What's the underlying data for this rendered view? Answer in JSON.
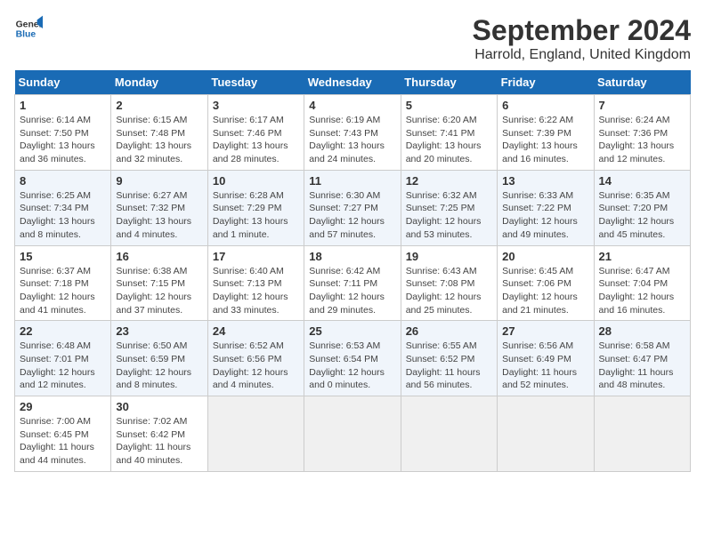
{
  "header": {
    "logo_line1": "General",
    "logo_line2": "Blue",
    "month_title": "September 2024",
    "location": "Harrold, England, United Kingdom"
  },
  "days_of_week": [
    "Sunday",
    "Monday",
    "Tuesday",
    "Wednesday",
    "Thursday",
    "Friday",
    "Saturday"
  ],
  "weeks": [
    [
      {
        "day": "1",
        "info": "Sunrise: 6:14 AM\nSunset: 7:50 PM\nDaylight: 13 hours\nand 36 minutes."
      },
      {
        "day": "2",
        "info": "Sunrise: 6:15 AM\nSunset: 7:48 PM\nDaylight: 13 hours\nand 32 minutes."
      },
      {
        "day": "3",
        "info": "Sunrise: 6:17 AM\nSunset: 7:46 PM\nDaylight: 13 hours\nand 28 minutes."
      },
      {
        "day": "4",
        "info": "Sunrise: 6:19 AM\nSunset: 7:43 PM\nDaylight: 13 hours\nand 24 minutes."
      },
      {
        "day": "5",
        "info": "Sunrise: 6:20 AM\nSunset: 7:41 PM\nDaylight: 13 hours\nand 20 minutes."
      },
      {
        "day": "6",
        "info": "Sunrise: 6:22 AM\nSunset: 7:39 PM\nDaylight: 13 hours\nand 16 minutes."
      },
      {
        "day": "7",
        "info": "Sunrise: 6:24 AM\nSunset: 7:36 PM\nDaylight: 13 hours\nand 12 minutes."
      }
    ],
    [
      {
        "day": "8",
        "info": "Sunrise: 6:25 AM\nSunset: 7:34 PM\nDaylight: 13 hours\nand 8 minutes."
      },
      {
        "day": "9",
        "info": "Sunrise: 6:27 AM\nSunset: 7:32 PM\nDaylight: 13 hours\nand 4 minutes."
      },
      {
        "day": "10",
        "info": "Sunrise: 6:28 AM\nSunset: 7:29 PM\nDaylight: 13 hours\nand 1 minute."
      },
      {
        "day": "11",
        "info": "Sunrise: 6:30 AM\nSunset: 7:27 PM\nDaylight: 12 hours\nand 57 minutes."
      },
      {
        "day": "12",
        "info": "Sunrise: 6:32 AM\nSunset: 7:25 PM\nDaylight: 12 hours\nand 53 minutes."
      },
      {
        "day": "13",
        "info": "Sunrise: 6:33 AM\nSunset: 7:22 PM\nDaylight: 12 hours\nand 49 minutes."
      },
      {
        "day": "14",
        "info": "Sunrise: 6:35 AM\nSunset: 7:20 PM\nDaylight: 12 hours\nand 45 minutes."
      }
    ],
    [
      {
        "day": "15",
        "info": "Sunrise: 6:37 AM\nSunset: 7:18 PM\nDaylight: 12 hours\nand 41 minutes."
      },
      {
        "day": "16",
        "info": "Sunrise: 6:38 AM\nSunset: 7:15 PM\nDaylight: 12 hours\nand 37 minutes."
      },
      {
        "day": "17",
        "info": "Sunrise: 6:40 AM\nSunset: 7:13 PM\nDaylight: 12 hours\nand 33 minutes."
      },
      {
        "day": "18",
        "info": "Sunrise: 6:42 AM\nSunset: 7:11 PM\nDaylight: 12 hours\nand 29 minutes."
      },
      {
        "day": "19",
        "info": "Sunrise: 6:43 AM\nSunset: 7:08 PM\nDaylight: 12 hours\nand 25 minutes."
      },
      {
        "day": "20",
        "info": "Sunrise: 6:45 AM\nSunset: 7:06 PM\nDaylight: 12 hours\nand 21 minutes."
      },
      {
        "day": "21",
        "info": "Sunrise: 6:47 AM\nSunset: 7:04 PM\nDaylight: 12 hours\nand 16 minutes."
      }
    ],
    [
      {
        "day": "22",
        "info": "Sunrise: 6:48 AM\nSunset: 7:01 PM\nDaylight: 12 hours\nand 12 minutes."
      },
      {
        "day": "23",
        "info": "Sunrise: 6:50 AM\nSunset: 6:59 PM\nDaylight: 12 hours\nand 8 minutes."
      },
      {
        "day": "24",
        "info": "Sunrise: 6:52 AM\nSunset: 6:56 PM\nDaylight: 12 hours\nand 4 minutes."
      },
      {
        "day": "25",
        "info": "Sunrise: 6:53 AM\nSunset: 6:54 PM\nDaylight: 12 hours\nand 0 minutes."
      },
      {
        "day": "26",
        "info": "Sunrise: 6:55 AM\nSunset: 6:52 PM\nDaylight: 11 hours\nand 56 minutes."
      },
      {
        "day": "27",
        "info": "Sunrise: 6:56 AM\nSunset: 6:49 PM\nDaylight: 11 hours\nand 52 minutes."
      },
      {
        "day": "28",
        "info": "Sunrise: 6:58 AM\nSunset: 6:47 PM\nDaylight: 11 hours\nand 48 minutes."
      }
    ],
    [
      {
        "day": "29",
        "info": "Sunrise: 7:00 AM\nSunset: 6:45 PM\nDaylight: 11 hours\nand 44 minutes."
      },
      {
        "day": "30",
        "info": "Sunrise: 7:02 AM\nSunset: 6:42 PM\nDaylight: 11 hours\nand 40 minutes."
      },
      {
        "day": "",
        "info": ""
      },
      {
        "day": "",
        "info": ""
      },
      {
        "day": "",
        "info": ""
      },
      {
        "day": "",
        "info": ""
      },
      {
        "day": "",
        "info": ""
      }
    ]
  ]
}
